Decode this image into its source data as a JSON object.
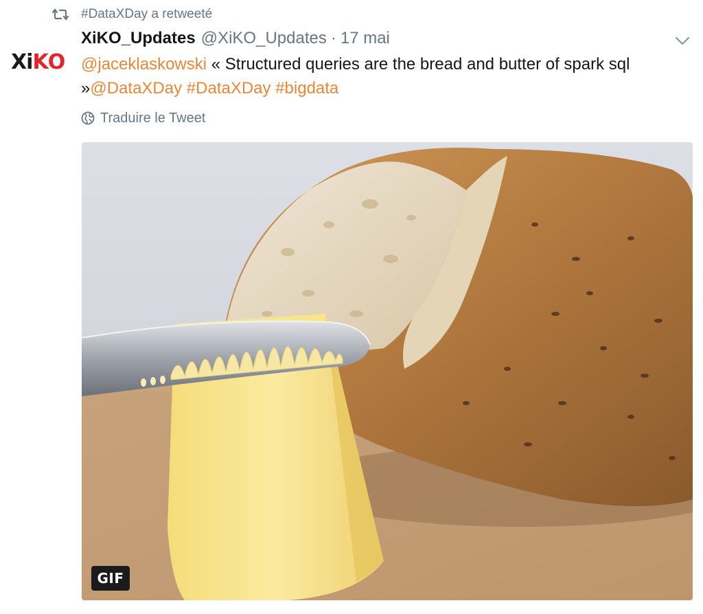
{
  "retweet": {
    "label": "#DataXDay a retweeté",
    "icon": "retweet-icon"
  },
  "author": {
    "fullname": "XiKO_Updates",
    "username": "@XiKO_Updates",
    "separator": "·",
    "timestamp": "17 mai",
    "avatar_logo": "XiKO"
  },
  "tweet": {
    "mention": "@jaceklaskowski",
    "text_part": " « Structured queries are the bread and butter of spark sql »",
    "mention2": "@DataXDay",
    "hashtag1": "#DataXDay",
    "hashtag2": "#bigdata"
  },
  "translate": {
    "label": "Traduire le Tweet",
    "icon": "globe-icon"
  },
  "media": {
    "type": "gif",
    "badge": "GIF",
    "subject": "butter-knife-on-butter-with-bread"
  },
  "colors": {
    "link": "#e8873a",
    "secondary_text": "#657786",
    "primary_text": "#14171a",
    "logo_red": "#e3242b"
  }
}
